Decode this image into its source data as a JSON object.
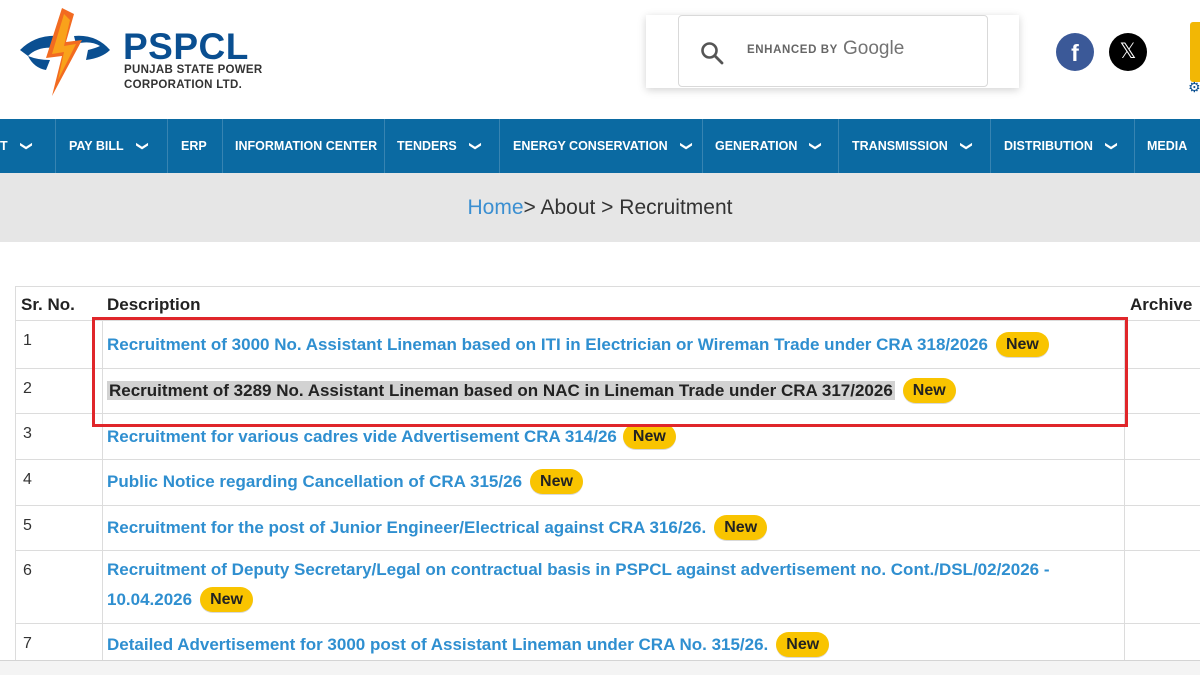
{
  "header": {
    "logo_title": "PSPCL",
    "logo_sub1": "PUNJAB STATE POWER",
    "logo_sub2": "CORPORATION LTD.",
    "search_placeholder": "ENHANCED BY",
    "search_brand": "Google",
    "facebook_glyph": "f",
    "x_glyph": "𝕏"
  },
  "nav": {
    "items": [
      {
        "label": "T"
      },
      {
        "label": "PAY BILL"
      },
      {
        "label": "ERP"
      },
      {
        "label": "INFORMATION CENTER"
      },
      {
        "label": "TENDERS"
      },
      {
        "label": "ENERGY CONSERVATION"
      },
      {
        "label": "GENERATION"
      },
      {
        "label": "TRANSMISSION"
      },
      {
        "label": "DISTRIBUTION"
      },
      {
        "label": "MEDIA"
      }
    ]
  },
  "breadcrumb": {
    "home": "Home",
    "rest": "> About > Recruitment"
  },
  "table": {
    "headers": {
      "sr": "Sr. No.",
      "desc": "Description",
      "archive": "Archive"
    },
    "badge_label": "New",
    "rows": [
      {
        "sr": "1",
        "desc": "Recruitment of 3000 No. Assistant Lineman based on ITI in Electrician or Wireman Trade under CRA 318/2026"
      },
      {
        "sr": "2",
        "desc": "Recruitment of 3289 No. Assistant Lineman based on NAC in Lineman Trade under CRA 317/2026"
      },
      {
        "sr": "3",
        "desc": "Recruitment for various cadres vide Advertisement CRA 314/26"
      },
      {
        "sr": "4",
        "desc": "Public Notice regarding Cancellation of CRA 315/26"
      },
      {
        "sr": "5",
        "desc": "Recruitment for the post of Junior Engineer/Electrical against CRA 316/26."
      },
      {
        "sr": "6",
        "desc_line1": "Recruitment of Deputy Secretary/Legal on contractual basis in PSPCL against advertisement no. Cont./DSL/02/2026 -",
        "desc_line2": "10.04.2026"
      },
      {
        "sr": "7",
        "desc": "Detailed Advertisement for 3000 post of Assistant Lineman under CRA No. 315/26."
      }
    ]
  },
  "colors": {
    "nav_bg": "#0b6aa2",
    "link": "#2f8fd0",
    "badge": "#f9c400",
    "annotation": "#e0262a",
    "brand_blue": "#0a4f91"
  }
}
